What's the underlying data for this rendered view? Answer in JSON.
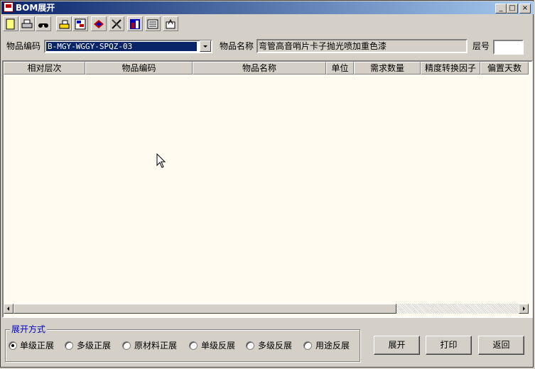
{
  "window": {
    "title": "BOM展开",
    "minimize_glyph": "_",
    "maximize_glyph": "□",
    "close_glyph": "×"
  },
  "toolbar": {
    "buttons": [
      {
        "icon": "new-document-icon"
      },
      {
        "icon": "printer-icon"
      },
      {
        "icon": "binoculars-icon"
      },
      {
        "icon": "print-preview-icon"
      },
      {
        "icon": "grid-select-icon"
      },
      {
        "icon": "tree-expand-icon"
      },
      {
        "icon": "tools-icon"
      },
      {
        "icon": "chart-icon"
      },
      {
        "icon": "list-icon"
      },
      {
        "icon": "export-icon"
      }
    ]
  },
  "filters": {
    "item_code_label": "物品编码",
    "item_code_value": "B-MGY-WGGY-SPQZ-03",
    "item_name_label": "物品名称",
    "item_name_value": "弯管高音哨片卡子抛光喷加重色漆",
    "level_label": "层号",
    "level_value": ""
  },
  "grid": {
    "columns": [
      "相对层次",
      "物品编码",
      "物品名称",
      "单位",
      "需求数量",
      "精度转换因子",
      "偏置天数"
    ],
    "rows": []
  },
  "expand_mode": {
    "title": "展开方式",
    "options": [
      {
        "label": "单级正展",
        "selected": true
      },
      {
        "label": "多级正展",
        "selected": false
      },
      {
        "label": "原材料正展",
        "selected": false
      },
      {
        "label": "单级反展",
        "selected": false
      },
      {
        "label": "多级反展",
        "selected": false
      },
      {
        "label": "用途反展",
        "selected": false
      }
    ]
  },
  "actions": {
    "expand_label": "展开",
    "print_label": "打印",
    "back_label": "返回"
  }
}
